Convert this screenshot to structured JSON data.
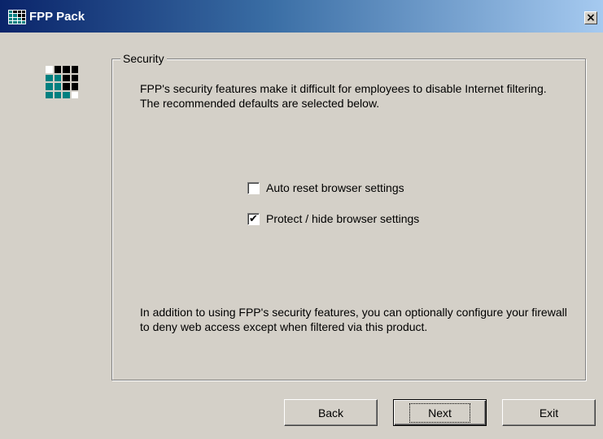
{
  "window": {
    "title": "FPP Pack",
    "close_label": "×",
    "title_gradient": [
      "#0a246a",
      "#a6caf0"
    ]
  },
  "security": {
    "group_label": "Security",
    "description": "FPP's security features make it difficult for employees to disable Internet filtering.  The recommended defaults are selected below.",
    "options": [
      {
        "label": "Auto reset browser settings",
        "checked": false,
        "mark": ""
      },
      {
        "label": "Protect / hide browser settings",
        "checked": true,
        "mark": "✔"
      }
    ],
    "footer": "In addition to using FPP's security features, you can optionally configure your firewall to deny web access except when filtered via this product."
  },
  "buttons": {
    "back": "Back",
    "next": "Next",
    "exit": "Exit"
  },
  "logo_colors": {
    "dark": "#000000",
    "teal": "#008080"
  }
}
